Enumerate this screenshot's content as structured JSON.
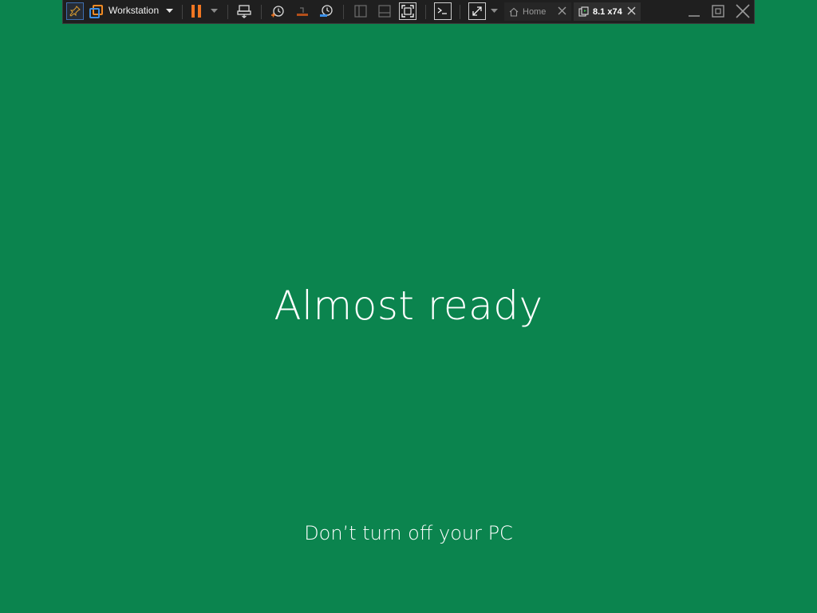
{
  "toolbar": {
    "product_label": "Workstation",
    "tabs": [
      {
        "label": "Home",
        "active": false
      },
      {
        "label": "8.1 x74",
        "active": true
      }
    ]
  },
  "screen": {
    "headline": "Almost ready",
    "subline": "Don’t turn off your PC",
    "background_color": "#0b844e",
    "text_color": "#ffffff"
  },
  "icons": {
    "pin": "pin-icon",
    "vmware": "vmware-logo-icon",
    "pause": "pause-icon",
    "send_keys": "send-ctrl-alt-del-icon",
    "snapshot": "snapshot-icon",
    "revert": "revert-snapshot-icon",
    "snapshot_manager": "snapshot-manager-icon",
    "library": "library-view-icon",
    "thumbnail": "thumbnail-bar-icon",
    "unity": "fit-guest-icon",
    "console": "console-view-icon",
    "fullscreen": "fullscreen-icon",
    "home": "home-icon",
    "vm": "virtual-machine-icon",
    "close": "close-icon",
    "minimize": "minimize-icon",
    "restore": "restore-icon"
  }
}
